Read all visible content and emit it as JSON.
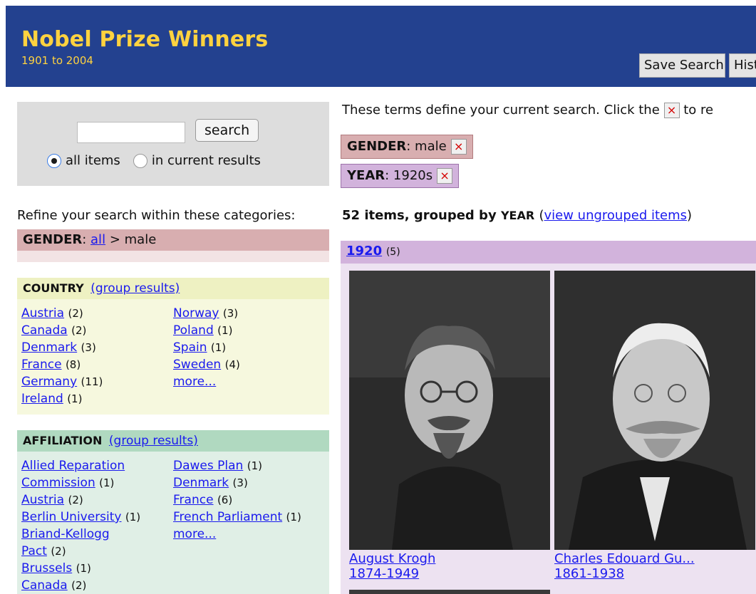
{
  "header": {
    "title": "Nobel Prize Winners",
    "subtitle": "1901 to 2004",
    "save_search_label": "Save Search",
    "history_label": "History"
  },
  "search": {
    "input_value": "",
    "button_label": "search",
    "radio_all_label": "all items",
    "radio_current_label": "in current results",
    "selected": "all items"
  },
  "refine": {
    "label": "Refine your search within these categories:",
    "gender": {
      "name": "GENDER",
      "all_link": "all",
      "separator": ">",
      "value": "male"
    }
  },
  "country_facet": {
    "title": "COUNTRY",
    "group_link": "(group results)",
    "col1": [
      {
        "label": "Austria",
        "count": "(2)"
      },
      {
        "label": "Canada",
        "count": "(2)"
      },
      {
        "label": "Denmark",
        "count": "(3)"
      },
      {
        "label": "France",
        "count": "(8)"
      },
      {
        "label": "Germany",
        "count": "(11)"
      },
      {
        "label": "Ireland",
        "count": "(1)"
      }
    ],
    "col2": [
      {
        "label": "Norway",
        "count": "(3)"
      },
      {
        "label": "Poland",
        "count": "(1)"
      },
      {
        "label": "Spain",
        "count": "(1)"
      },
      {
        "label": "Sweden",
        "count": "(4)"
      },
      {
        "label": "more...",
        "count": ""
      }
    ]
  },
  "affiliation_facet": {
    "title": "AFFILIATION",
    "group_link": "(group results)",
    "col1": [
      {
        "label_line1": "Allied Reparation",
        "label_line2": "Commission",
        "count": "(1)"
      },
      {
        "label": "Austria",
        "count": "(2)"
      },
      {
        "label": "Berlin University",
        "count": "(1)"
      },
      {
        "label_line1": "Briand-Kellogg",
        "label_line2": "Pact",
        "count": "(2)"
      },
      {
        "label": "Brussels",
        "count": "(1)"
      },
      {
        "label": "Canada",
        "count": "(2)"
      }
    ],
    "col2": [
      {
        "label": "Dawes Plan",
        "count": "(1)"
      },
      {
        "label": "Denmark",
        "count": "(3)"
      },
      {
        "label": "France",
        "count": "(6)"
      },
      {
        "label": "French Parliament",
        "count": "(1)"
      },
      {
        "label": "more...",
        "count": ""
      }
    ]
  },
  "terms": {
    "intro": "These terms define your current search. Click the",
    "intro_after": "to re",
    "x_glyph": "×",
    "items": [
      {
        "name": "GENDER",
        "value": "male"
      },
      {
        "name": "YEAR",
        "value": "1920s"
      }
    ]
  },
  "results": {
    "count_text": "52 items, grouped by",
    "group_field": "YEAR",
    "ungrouped_link": "view ungrouped items"
  },
  "group": {
    "year": "1920",
    "count": "(5)",
    "cards": [
      {
        "name": "August Krogh",
        "years": "1874-1949"
      },
      {
        "name": "Charles Edouard Gu...",
        "years": "1861-1938"
      }
    ]
  }
}
